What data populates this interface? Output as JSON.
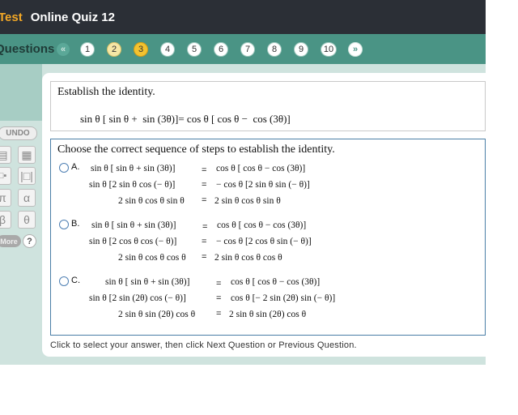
{
  "header": {
    "test_label": "Test",
    "quiz_title": "Online Quiz 12"
  },
  "questions_bar": {
    "label": "Questions",
    "prev_icon": "double-chevron-left-icon",
    "next_icon": "double-chevron-right-icon",
    "numbers": [
      "1",
      "2",
      "3",
      "4",
      "5",
      "6",
      "7",
      "8",
      "9",
      "10"
    ]
  },
  "tools": {
    "undo": "UNDO",
    "symbols": [
      "π",
      "α",
      "β",
      "θ"
    ],
    "more": "More",
    "help": "?"
  },
  "prompt": {
    "instruction": "Establish the identity.",
    "identity": "sin θ [ sin θ +  sin (3θ)]= cos θ [ cos θ −  cos (3θ)]"
  },
  "choices": {
    "heading": "Choose the correct sequence of steps to establish the identity.",
    "options": [
      {
        "letter": "A.",
        "lines": [
          [
            "sin θ [ sin θ + sin (3θ)]",
            "=",
            "cos θ [ cos θ − cos (3θ)]"
          ],
          [
            "sin θ [2 sin θ cos (− θ)]",
            "=",
            "− cos θ [2 sin θ sin (− θ)]"
          ],
          [
            "2 sin θ cos θ sin θ",
            "=",
            "2 sin θ cos θ sin θ"
          ]
        ]
      },
      {
        "letter": "B.",
        "lines": [
          [
            "sin θ [ sin θ + sin (3θ)]",
            "=",
            "cos θ [ cos θ − cos (3θ)]"
          ],
          [
            "sin θ [2 cos θ cos (− θ)]",
            "=",
            "− cos θ [2 cos θ sin (− θ)]"
          ],
          [
            "2 sin θ cos θ cos θ",
            "=",
            "2 sin θ cos θ cos θ"
          ]
        ]
      },
      {
        "letter": "C.",
        "lines": [
          [
            "sin θ [ sin θ + sin (3θ)]",
            "=",
            "cos θ [ cos θ − cos (3θ)]"
          ],
          [
            "sin θ [2 sin (2θ) cos (− θ)]",
            "=",
            "cos θ [− 2 sin (2θ) sin (− θ)]"
          ],
          [
            "2 sin θ sin (2θ) cos θ",
            "=",
            "2 sin θ sin (2θ) cos θ"
          ]
        ]
      }
    ]
  },
  "footer": {
    "instructions": "Click to select your answer, then click Next Question or Previous Question."
  },
  "colors": {
    "header_bg": "#2b2f36",
    "accent_orange": "#f3a826",
    "teal_bar": "#4a9485",
    "current_question": "#f3c330"
  }
}
